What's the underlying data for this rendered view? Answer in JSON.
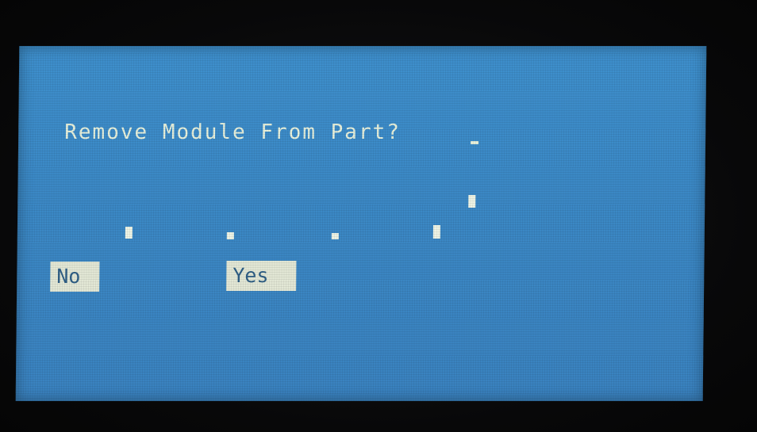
{
  "dialog": {
    "prompt": "Remove Module From Part?",
    "no_label": "No",
    "yes_label": "Yes"
  },
  "colors": {
    "screen_background": "#3b88c5",
    "text": "#e8f1dc",
    "button_background": "#e3e8d6",
    "button_text": "#2f5f86"
  }
}
